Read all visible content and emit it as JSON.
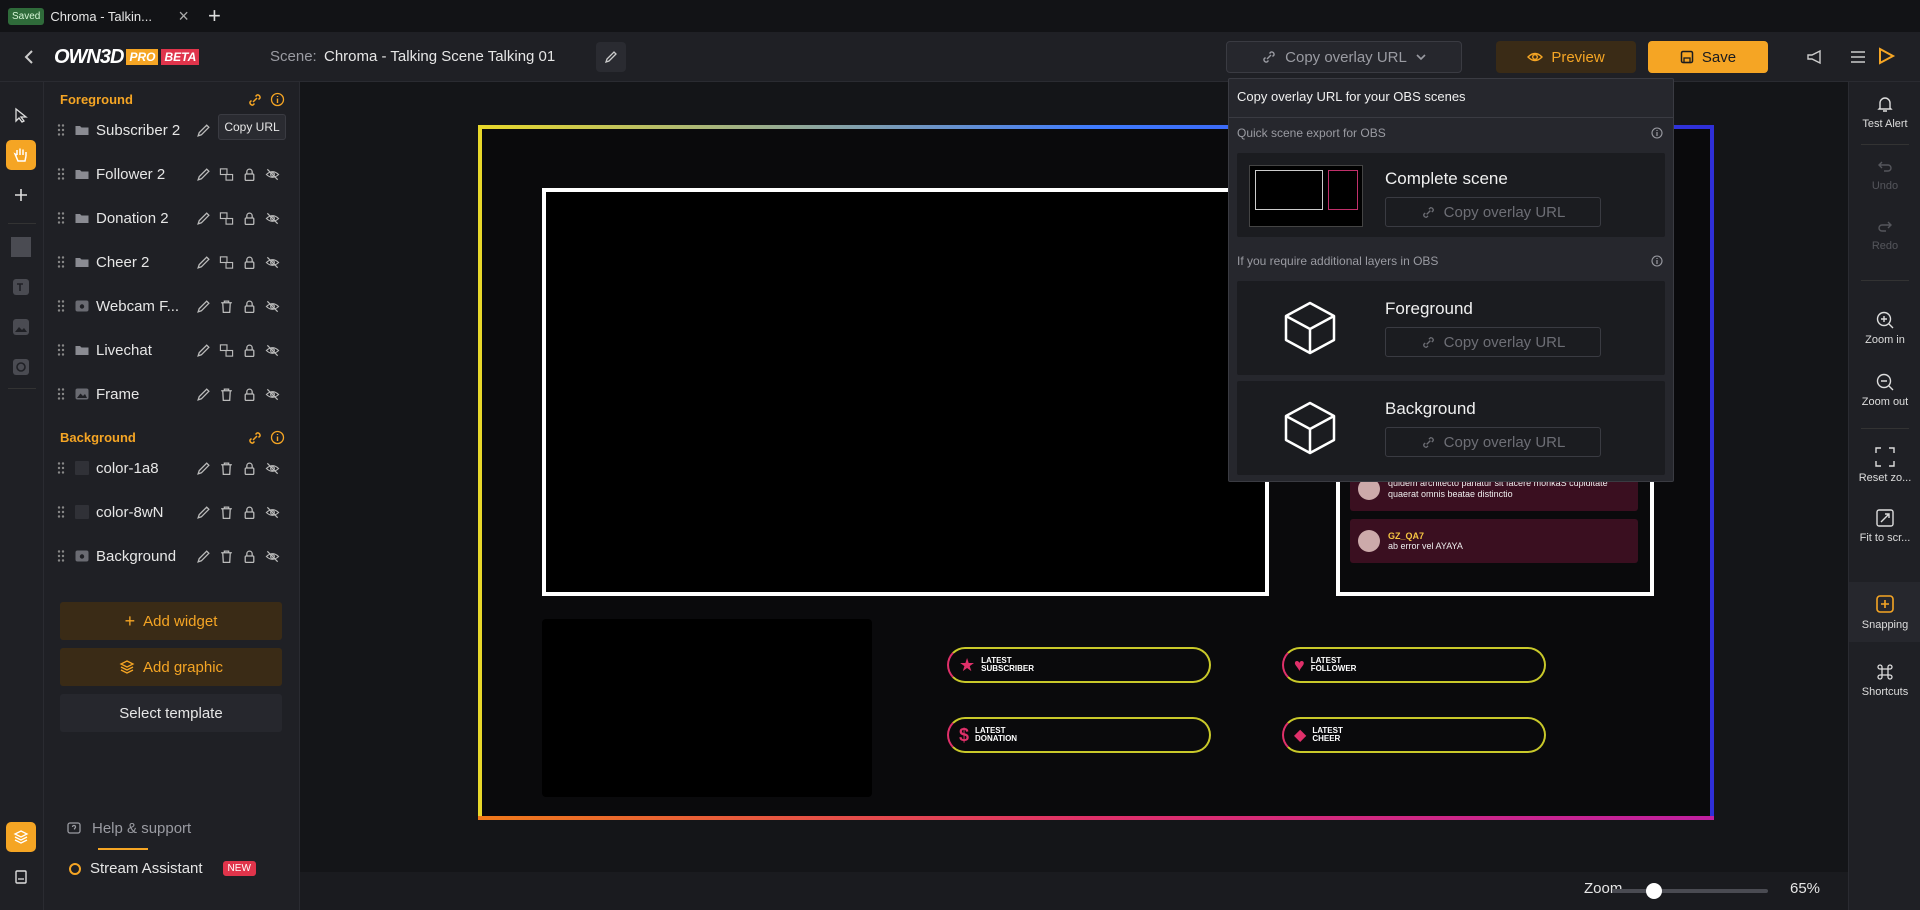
{
  "tab": {
    "saved_badge": "Saved",
    "title": "Chroma - Talkin...",
    "close": "×",
    "new": "+"
  },
  "header": {
    "logo_text": "OWN3D",
    "logo_pro": "PRO",
    "logo_beta": "BETA",
    "scene_label": "Scene:",
    "scene_name": "Chroma - Talking Scene Talking 01",
    "copy_overlay_url": "Copy overlay URL",
    "preview": "Preview",
    "save": "Save"
  },
  "layers": {
    "foreground_title": "Foreground",
    "background_title": "Background",
    "tooltip": "Copy URL",
    "foreground_items": [
      {
        "label": "Subscriber 2",
        "icon": "folder-icon"
      },
      {
        "label": "Follower 2",
        "icon": "folder-icon"
      },
      {
        "label": "Donation 2",
        "icon": "folder-icon"
      },
      {
        "label": "Cheer 2",
        "icon": "folder-icon"
      },
      {
        "label": "Webcam F...",
        "icon": "webcam-icon"
      },
      {
        "label": "Livechat",
        "icon": "folder-icon"
      },
      {
        "label": "Frame",
        "icon": "image-icon"
      }
    ],
    "background_items": [
      {
        "label": "color-1a8",
        "icon": "color-swatch-icon"
      },
      {
        "label": "color-8wN",
        "icon": "color-swatch-icon"
      },
      {
        "label": "Background",
        "icon": "webcam-icon"
      }
    ],
    "add_widget": "Add widget",
    "add_graphic": "Add graphic",
    "select_template": "Select template",
    "help": "Help & support",
    "assistant": "Stream Assistant",
    "new_badge": "NEW"
  },
  "right_rail": {
    "test_alert": "Test Alert",
    "undo": "Undo",
    "redo": "Redo",
    "zoom_in": "Zoom in",
    "zoom_out": "Zoom out",
    "reset_zoom": "Reset zo...",
    "fit_screen": "Fit to scr...",
    "snapping": "Snapping",
    "shortcuts": "Shortcuts"
  },
  "zoom": {
    "label": "Zoom",
    "value": "65%",
    "level": 0.65
  },
  "popup": {
    "title": "Copy overlay URL for your OBS scenes",
    "quick_export": "Quick scene export for OBS",
    "additional_layers": "If you require additional layers in OBS",
    "cards": [
      {
        "title": "Complete scene",
        "button": "Copy overlay URL"
      },
      {
        "title": "Foreground",
        "button": "Copy overlay URL"
      },
      {
        "title": "Background",
        "button": "Copy overlay URL"
      }
    ]
  },
  "overlay": {
    "latest_subscriber": [
      "LATEST",
      "SUBSCRIBER"
    ],
    "latest_follower": [
      "LATEST",
      "FOLLOWER"
    ],
    "latest_donation": [
      "LATEST",
      "DONATION"
    ],
    "latest_cheer": [
      "LATEST",
      "CHEER"
    ],
    "chat": [
      {
        "user": "",
        "message": "quidem architecto pariatur sit facere monkaS cupiditate quaerat omnis beatae distinctio"
      },
      {
        "user": "GZ_QA7",
        "message": "ab error vel AYAYA"
      }
    ]
  },
  "colors": {
    "accent": "#f5a524",
    "save_bg": "#f5a524",
    "badge_new": "#e0344b",
    "pink": "#e0306a"
  }
}
